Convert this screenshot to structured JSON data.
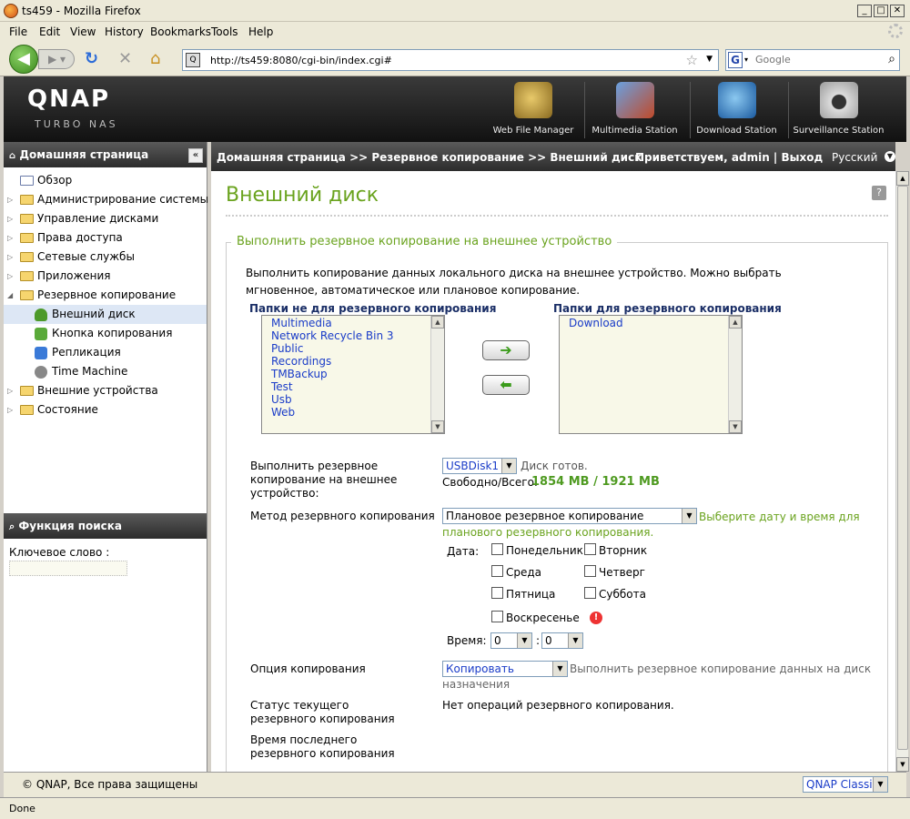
{
  "browser": {
    "window_title": "ts459 - Mozilla Firefox",
    "menu": [
      "File",
      "Edit",
      "View",
      "History",
      "Bookmarks",
      "Tools",
      "Help"
    ],
    "url": "http://ts459:8080/cgi-bin/index.cgi#",
    "search_placeholder": "Google",
    "status": "Done"
  },
  "header": {
    "logo": "QNAP",
    "logo_sub": "TURBO NAS",
    "apps": [
      "Web File Manager",
      "Multimedia Station",
      "Download Station",
      "Surveillance Station"
    ]
  },
  "sidebar": {
    "title": "Домашняя страница",
    "items": [
      {
        "label": "Обзор"
      },
      {
        "label": "Администрирование системы"
      },
      {
        "label": "Управление дисками"
      },
      {
        "label": "Права доступа"
      },
      {
        "label": "Сетевые службы"
      },
      {
        "label": "Приложения"
      },
      {
        "label": "Резервное копирование"
      },
      {
        "label": "Внешний диск"
      },
      {
        "label": "Кнопка копирования"
      },
      {
        "label": "Репликация"
      },
      {
        "label": "Time Machine"
      },
      {
        "label": "Внешние устройства"
      },
      {
        "label": "Состояние"
      }
    ],
    "search_title": "Функция поиска",
    "keyword_label": "Ключевое слово :"
  },
  "topbar": {
    "breadcrumb": "Домашняя страница >> Резервное копирование >> Внешний диск",
    "welcome": "Приветствуем, admin | Выход",
    "language": "Русский"
  },
  "page": {
    "title": "Внешний диск",
    "section_title": "Выполнить резервное копирование на внешнее устройство",
    "description": "Выполнить копирование данных локального диска на внешнее устройство. Можно выбрать мгновенное, автоматическое или плановое копирование.",
    "left_list_header": "Папки не для резервного копирования",
    "left_list": [
      "Multimedia",
      "Network Recycle Bin 3",
      "Public",
      "Recordings",
      "TMBackup",
      "Test",
      "Usb",
      "Web"
    ],
    "right_list_header": "Папки для резервного копирования",
    "right_list": [
      "Download"
    ],
    "move_right": "➔",
    "move_left": "⬅",
    "device_label": "Выполнить резервное копирование на внешнее устройство:",
    "device_value": "USBDisk1",
    "device_status": "Диск готов.",
    "free_label": "Свободно/Всего:",
    "free_value": "1854 MB / 1921 MB",
    "method_label": "Метод резервного копирования",
    "method_value": "Плановое резервное копирование",
    "method_hint": "Выберите дату и время для планового резервного копирования.",
    "date_label": "Дата:",
    "days": [
      "Понедельник",
      "Вторник",
      "Среда",
      "Четверг",
      "Пятница",
      "Суббота",
      "Воскресенье"
    ],
    "time_label": "Время:",
    "hour": "0",
    "minute": "0",
    "time_sep": ":",
    "option_label": "Опция копирования",
    "option_value": "Копировать",
    "option_hint": "Выполнить резервное копирование данных на диск назначения",
    "status_label": "Статус текущего резервного копирования",
    "status_value": "Нет операций резервного копирования.",
    "last_label": "Время последнего резервного копирования"
  },
  "footer": {
    "copyright": "© QNAP, Все права защищены",
    "theme": "QNAP Classic"
  }
}
